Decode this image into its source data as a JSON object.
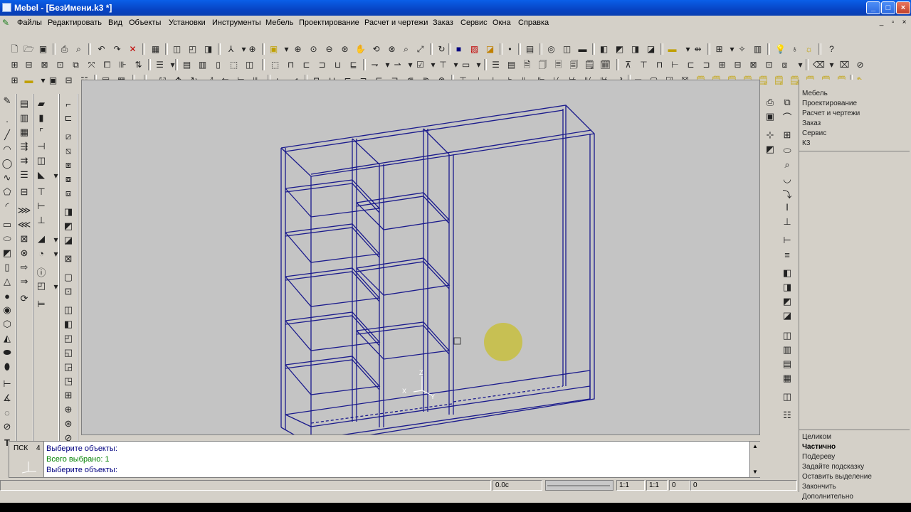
{
  "window": {
    "title": "Mebel - [БезИмени.k3 *]"
  },
  "menu": [
    "Файлы",
    "Редактировать",
    "Вид",
    "Объекты",
    "Установки",
    "Инструменты",
    "Мебель",
    "Проектирование",
    "Расчет и чертежи",
    "Заказ",
    "Сервис",
    "Окна",
    "Справка"
  ],
  "right_panel": {
    "tree": [
      "Мебель",
      "Проектирование",
      "Расчет и чертежи",
      "Заказ",
      "Сервис",
      "К3"
    ],
    "options": [
      "Целиком",
      "Частично",
      "ПоДереву",
      "Задайте подсказку",
      "Оставить выделение",
      "Закончить",
      "Дополнительно"
    ],
    "selected_option": "Частично"
  },
  "command": {
    "psk_label": "ПСК",
    "psk_value": "4",
    "lines": [
      "Выберите объекты:",
      "Всего выбрано: 1",
      "Выберите объекты:"
    ],
    "line_colors": [
      "#000080",
      "#008000",
      "#000080"
    ]
  },
  "status": {
    "time": "0.0c",
    "scale1": "1:1",
    "scale2": "1:1",
    "v1": "0",
    "v2": "0"
  },
  "viewport": {
    "background": "#c4c4c4",
    "wireframe_color": "#1a1a8c",
    "axis_labels": {
      "x": "X",
      "y": "Y",
      "z": "Z"
    }
  },
  "colors": {
    "titlebar": "#0a5fe8",
    "cursor_highlight": "#c8c040"
  }
}
